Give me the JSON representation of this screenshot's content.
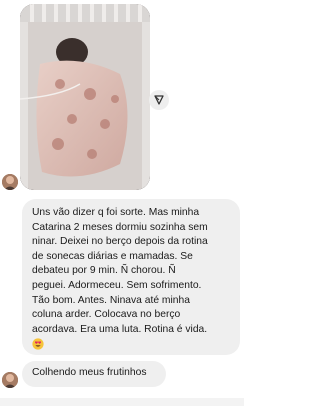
{
  "thread": {
    "media": {
      "kind": "photo",
      "description_icon": "baby-crib-photo"
    },
    "share_icon": "send-arrow-icon",
    "messages": [
      {
        "lines": [
          "Uns vão dizer q foi sorte. Mas minha",
          "Catarina 2 meses dormiu sozinha sem",
          "ninar. Deixei no berço depois da rotina",
          "de sonecas diárias e mamadas. Se",
          "debateu por 9 min. Ñ chorou. Ñ",
          "peguei. Adormeceu. Sem sofrimento.",
          "Tão bom. Antes. Ninava até minha",
          "coluna arder. Colocava no berço",
          "acordava. Era uma luta. Rotina é vida."
        ],
        "emoji": "heart-eyes-emoji"
      },
      {
        "text": "Colhendo meus frutinhos"
      }
    ]
  }
}
